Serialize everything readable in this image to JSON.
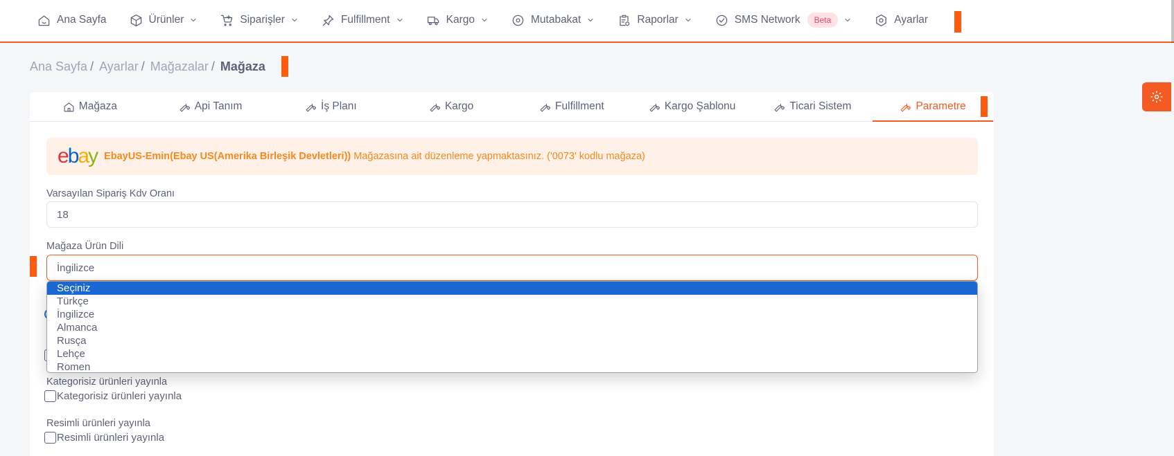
{
  "nav": {
    "items": [
      {
        "label": "Ana Sayfa",
        "icon": "home-icon"
      },
      {
        "label": "Ürünler",
        "icon": "box-icon"
      },
      {
        "label": "Siparişler",
        "icon": "cart-icon"
      },
      {
        "label": "Fulfillment",
        "icon": "pin-icon"
      },
      {
        "label": "Kargo",
        "icon": "truck-icon"
      },
      {
        "label": "Mutabakat",
        "icon": "eye-icon"
      },
      {
        "label": "Raporlar",
        "icon": "report-icon"
      },
      {
        "label": "SMS Network",
        "icon": "check-circle-icon",
        "badge": "Beta"
      },
      {
        "label": "Ayarlar",
        "icon": "hexagon-gear-icon"
      }
    ]
  },
  "breadcrumb": {
    "items": [
      "Ana Sayfa",
      "Ayarlar",
      "Mağazalar"
    ],
    "current": "Mağaza",
    "separator": "/"
  },
  "tabs": [
    {
      "label": "Mağaza",
      "icon": "home-icon"
    },
    {
      "label": "Api Tanım",
      "icon": "wrench-icon"
    },
    {
      "label": "İş Planı",
      "icon": "wrench-icon"
    },
    {
      "label": "Kargo",
      "icon": "wrench-icon"
    },
    {
      "label": "Fulfillment",
      "icon": "wrench-icon"
    },
    {
      "label": "Kargo Şablonu",
      "icon": "wrench-icon"
    },
    {
      "label": "Ticari Sistem",
      "icon": "wrench-icon"
    },
    {
      "label": "Parametre",
      "icon": "wrench-icon",
      "active": true
    }
  ],
  "alert": {
    "logo": "ebay",
    "store_name": "EbayUS-Emin(Ebay US(Amerika Birleşik Devletleri))",
    "message": "Mağazasına ait düzenleme yapmaktasınız. ('0073' kodlu mağaza)"
  },
  "form": {
    "kdv_label": "Varsayılan Sipariş Kdv Oranı",
    "kdv_value": "18",
    "language_label": "Mağaza Ürün Dili",
    "language_value": "İngilizce",
    "language_options": [
      "Seçiniz",
      "Türkçe",
      "İngilizce",
      "Almanca",
      "Rusça",
      "Lehçe",
      "Romen"
    ],
    "language_highlighted": "Seçiniz",
    "uncategorized_label": "Kategorisiz ürünleri yayınla",
    "uncategorized_checkbox": "Kategorisiz ürünleri yayınla",
    "with_image_label": "Resimli ürünleri yayınla",
    "with_image_checkbox": "Resimli ürünleri yayınla"
  },
  "colors": {
    "accent": "#f35b23",
    "marker": "#ff5b0f",
    "alert_bg": "#fff1e8",
    "alert_text": "#f58a1f",
    "select_highlight": "#1967d2"
  }
}
